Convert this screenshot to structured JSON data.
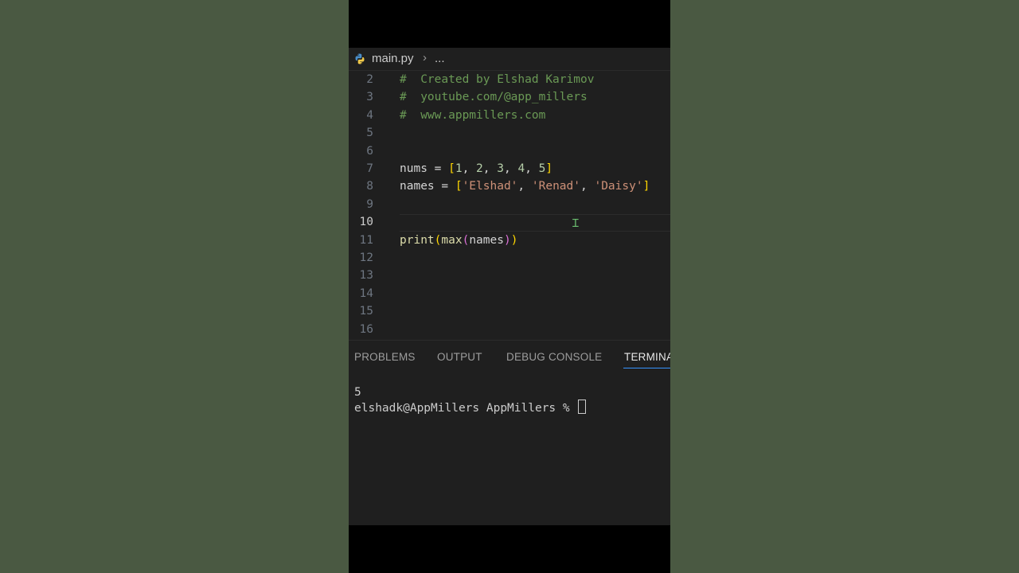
{
  "breadcrumb": {
    "file": "main.py",
    "rest": "..."
  },
  "editor": {
    "active_line": "10",
    "lines": [
      {
        "n": "2",
        "parts": [
          {
            "t": "#  Created by Elshad Karimov",
            "c": "c-com"
          }
        ]
      },
      {
        "n": "3",
        "parts": [
          {
            "t": "#  youtube.com/@app_millers",
            "c": "c-com"
          }
        ]
      },
      {
        "n": "4",
        "parts": [
          {
            "t": "#  www.appmillers.com",
            "c": "c-com"
          }
        ]
      },
      {
        "n": "5",
        "parts": []
      },
      {
        "n": "6",
        "parts": []
      },
      {
        "n": "7",
        "parts": [
          {
            "t": "nums = ",
            "c": "c-var"
          },
          {
            "t": "[",
            "c": "c-br1"
          },
          {
            "t": "1",
            "c": "c-num"
          },
          {
            "t": ", ",
            "c": "c-var"
          },
          {
            "t": "2",
            "c": "c-num"
          },
          {
            "t": ", ",
            "c": "c-var"
          },
          {
            "t": "3",
            "c": "c-num"
          },
          {
            "t": ", ",
            "c": "c-var"
          },
          {
            "t": "4",
            "c": "c-num"
          },
          {
            "t": ", ",
            "c": "c-var"
          },
          {
            "t": "5",
            "c": "c-num"
          },
          {
            "t": "]",
            "c": "c-br1"
          }
        ]
      },
      {
        "n": "8",
        "parts": [
          {
            "t": "names = ",
            "c": "c-var"
          },
          {
            "t": "[",
            "c": "c-br1"
          },
          {
            "t": "'Elshad'",
            "c": "c-str"
          },
          {
            "t": ", ",
            "c": "c-var"
          },
          {
            "t": "'Renad'",
            "c": "c-str"
          },
          {
            "t": ", ",
            "c": "c-var"
          },
          {
            "t": "'Daisy'",
            "c": "c-str"
          },
          {
            "t": "]",
            "c": "c-br1"
          }
        ]
      },
      {
        "n": "9",
        "parts": []
      },
      {
        "n": "10",
        "parts": []
      },
      {
        "n": "11",
        "parts": [
          {
            "t": "print",
            "c": "c-fn"
          },
          {
            "t": "(",
            "c": "c-br1"
          },
          {
            "t": "max",
            "c": "c-fn"
          },
          {
            "t": "(",
            "c": "c-br2"
          },
          {
            "t": "names",
            "c": "c-var"
          },
          {
            "t": ")",
            "c": "c-br2"
          },
          {
            "t": ")",
            "c": "c-br1"
          }
        ]
      },
      {
        "n": "12",
        "parts": []
      },
      {
        "n": "13",
        "parts": []
      },
      {
        "n": "14",
        "parts": []
      },
      {
        "n": "15",
        "parts": []
      },
      {
        "n": "16",
        "parts": []
      }
    ]
  },
  "panel": {
    "tabs": [
      "PROBLEMS",
      "OUTPUT",
      "DEBUG CONSOLE",
      "TERMINA"
    ],
    "active_tab": "TERMINA",
    "terminal": {
      "output": "5",
      "prompt": "elshadk@AppMillers AppMillers % "
    }
  },
  "colors": {
    "background": "#4a5942",
    "editor_bg": "#1f1f1f",
    "comment": "#6a9955",
    "string": "#ce9178",
    "function": "#dcdcaa",
    "bracket_1": "#ffd700",
    "bracket_2": "#da70d6",
    "active_tab_underline": "#3794ff"
  },
  "icons": {
    "breadcrumb_file": "python-icon",
    "breadcrumb_separator": "chevron-right-icon",
    "mouse_cursor": "text-cursor-icon"
  }
}
